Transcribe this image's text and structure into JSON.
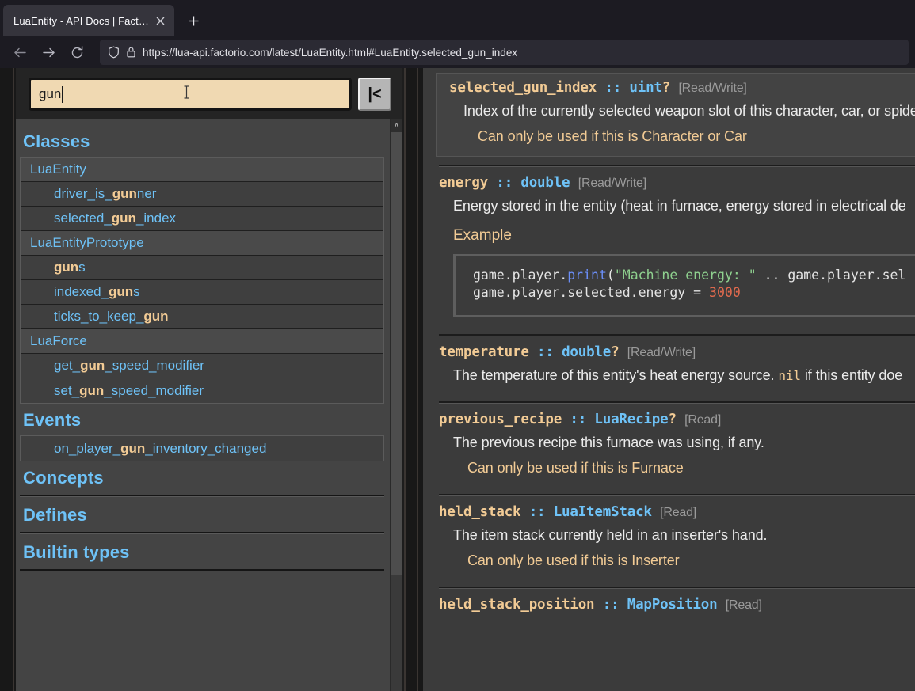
{
  "browser": {
    "tab": {
      "title": "LuaEntity - API Docs | Factorio",
      "close_icon": "close-icon"
    },
    "new_tab_label": "+",
    "nav": {
      "back_icon": "back-arrow-icon",
      "forward_icon": "forward-arrow-icon",
      "reload_icon": "reload-icon"
    },
    "urlbar": {
      "shield_icon": "shield-icon",
      "lock_icon": "lock-icon",
      "url": "https://lua-api.factorio.com/latest/LuaEntity.html#LuaEntity.selected_gun_index"
    }
  },
  "sidebar": {
    "search": {
      "value": "gun",
      "placeholder": "",
      "cursor_icon": "text-cursor-icon"
    },
    "collapse_button_label": "|<",
    "scrollbar": {
      "up_arrow": "∧"
    },
    "sections": [
      {
        "title": "Classes",
        "groups": [
          {
            "rows": [
              {
                "kind": "class",
                "pre": "LuaEntity",
                "hl": "",
                "post": ""
              },
              {
                "kind": "member",
                "pre": "driver_is_",
                "hl": "gun",
                "post": "ner"
              },
              {
                "kind": "member",
                "pre": "selected_",
                "hl": "gun",
                "post": "_index"
              },
              {
                "kind": "class",
                "pre": "LuaEntityPrototype",
                "hl": "",
                "post": ""
              },
              {
                "kind": "member",
                "pre": "",
                "hl": "gun",
                "post": "s"
              },
              {
                "kind": "member",
                "pre": "indexed_",
                "hl": "gun",
                "post": "s"
              },
              {
                "kind": "member",
                "pre": "ticks_to_keep_",
                "hl": "gun",
                "post": ""
              },
              {
                "kind": "class",
                "pre": "LuaForce",
                "hl": "",
                "post": ""
              },
              {
                "kind": "member",
                "pre": "get_",
                "hl": "gun",
                "post": "_speed_modifier"
              },
              {
                "kind": "member",
                "pre": "set_",
                "hl": "gun",
                "post": "_speed_modifier"
              }
            ]
          }
        ]
      },
      {
        "title": "Events",
        "groups": [
          {
            "rows": [
              {
                "kind": "event",
                "pre": "on_player_",
                "hl": "gun",
                "post": "_inventory_changed"
              }
            ]
          }
        ]
      },
      {
        "title": "Concepts",
        "groups": []
      },
      {
        "title": "Defines",
        "groups": []
      },
      {
        "title": "Builtin types",
        "groups": []
      }
    ]
  },
  "main": {
    "properties": [
      {
        "selected": true,
        "name": "selected_gun_index",
        "colons": "::",
        "type": "uint",
        "qmark": "?",
        "access": "[Read/Write]",
        "description": "Index of the currently selected weapon slot of this character, car, or spide",
        "note": "Can only be used if this is Character or Car",
        "example_label": "",
        "code_lines": []
      },
      {
        "selected": false,
        "name": "energy",
        "colons": "::",
        "type": "double",
        "qmark": "",
        "access": "[Read/Write]",
        "description": "Energy stored in the entity (heat in furnace, energy stored in electrical de",
        "note": "",
        "example_label": "Example",
        "code_lines": [
          "game.player.print(\"Machine energy: \" .. game.player.sel",
          "game.player.selected.energy = 3000"
        ]
      },
      {
        "selected": false,
        "name": "temperature",
        "colons": "::",
        "type": "double",
        "qmark": "?",
        "access": "[Read/Write]",
        "description": "The temperature of this entity's heat energy source. nil if this entity doe",
        "description_code_token": "nil",
        "note": "",
        "example_label": "",
        "code_lines": []
      },
      {
        "selected": false,
        "name": "previous_recipe",
        "colons": "::",
        "type": "LuaRecipe",
        "qmark": "?",
        "access": "[Read]",
        "description": "The previous recipe this furnace was using, if any.",
        "note": "Can only be used if this is Furnace",
        "example_label": "",
        "code_lines": []
      },
      {
        "selected": false,
        "name": "held_stack",
        "colons": "::",
        "type": "LuaItemStack",
        "qmark": "",
        "access": "[Read]",
        "description": "The item stack currently held in an inserter's hand.",
        "note": "Can only be used if this is Inserter",
        "example_label": "",
        "code_lines": []
      },
      {
        "selected": false,
        "name": "held_stack_position",
        "colons": "::",
        "type": "MapPosition",
        "qmark": "",
        "access": "[Read]",
        "description": "",
        "note": "",
        "example_label": "",
        "code_lines": []
      }
    ]
  },
  "colors": {
    "accent_blue": "#6ec2f7",
    "accent_tan": "#f2cb95",
    "search_bg": "#f0d9b2",
    "panel_bg": "#3b3b3b",
    "sidebar_bg": "#444444",
    "chrome_bg": "#1c1b22"
  }
}
